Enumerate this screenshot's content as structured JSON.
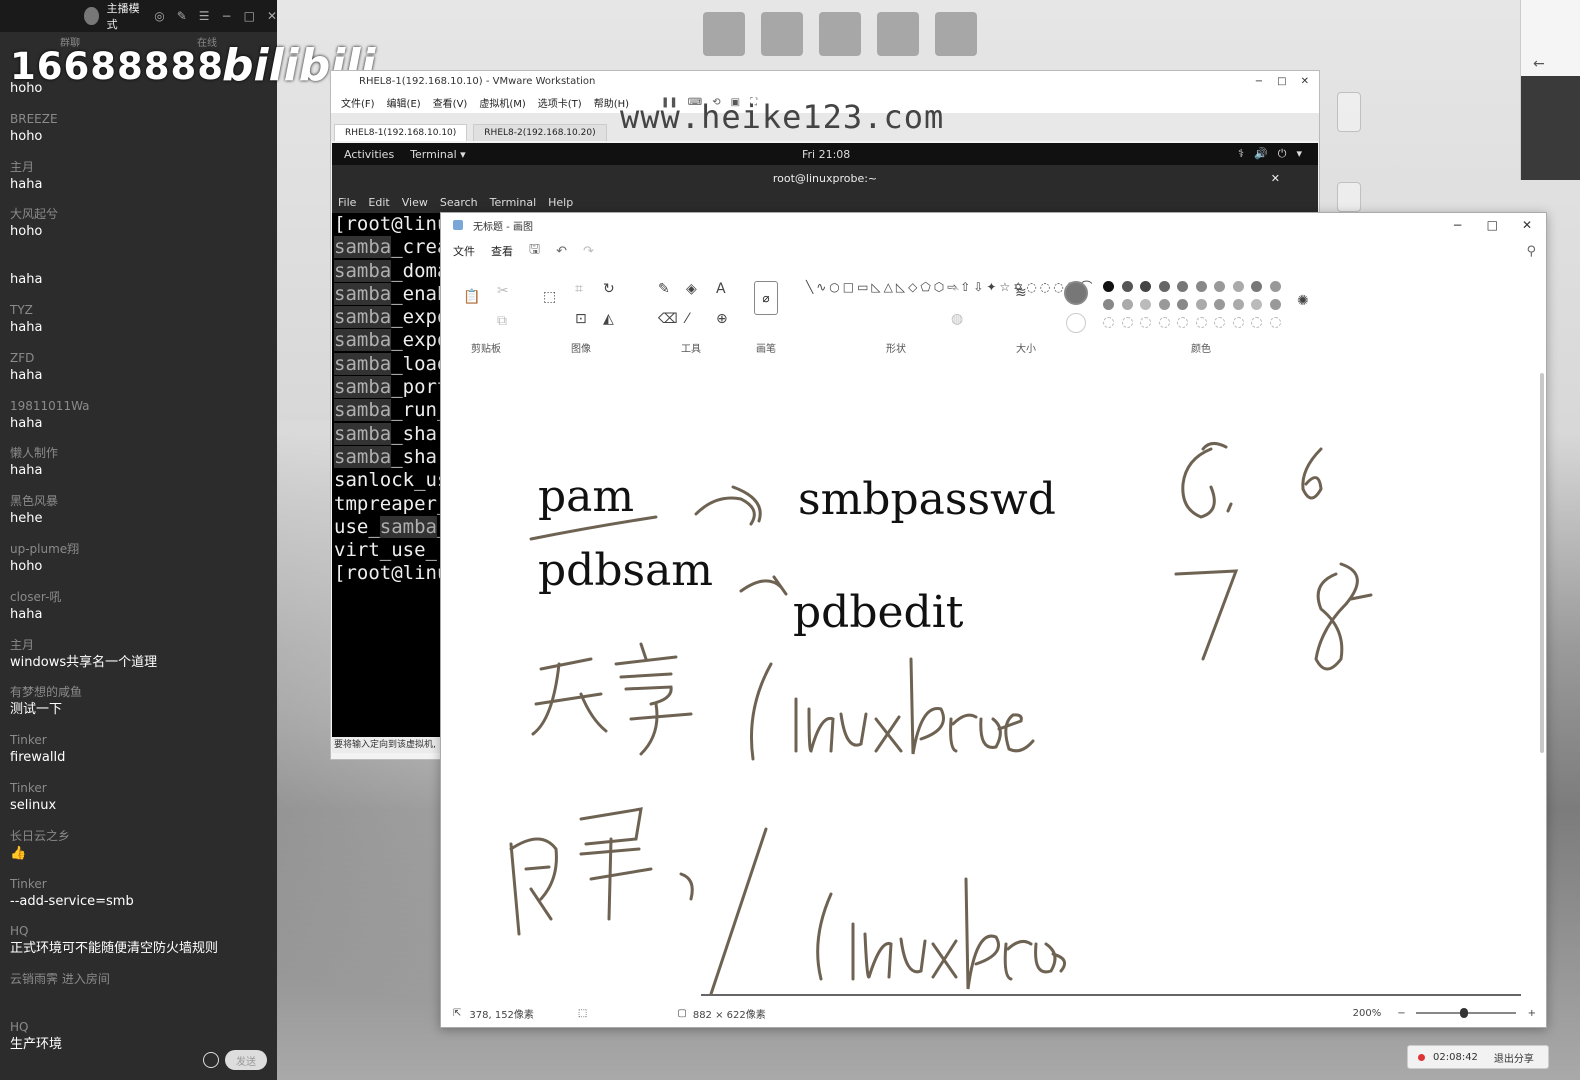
{
  "live": {
    "top_title": "主播模式",
    "tabs": [
      "群聊",
      "在线"
    ],
    "overlay_number": "16688888",
    "overlay_logo": "bilibili",
    "messages": [
      {
        "user": "",
        "text": "hoho"
      },
      {
        "user": "BREEZE",
        "text": "hoho"
      },
      {
        "user": "主月",
        "text": "haha"
      },
      {
        "user": "大风起兮",
        "text": "hoho"
      },
      {
        "user": "",
        "text": "haha"
      },
      {
        "user": "TYZ",
        "text": "haha"
      },
      {
        "user": "ZFD",
        "text": "haha"
      },
      {
        "user": "19811011Wa",
        "text": "haha"
      },
      {
        "user": "懒人制作",
        "text": "haha"
      },
      {
        "user": "黑色风暴",
        "text": "hehe"
      },
      {
        "user": "up-plume翔",
        "text": "hoho"
      },
      {
        "user": "closer-吼",
        "text": "haha"
      },
      {
        "user": "主月",
        "text": "windows共享名一个道理"
      },
      {
        "user": "有梦想的咸鱼",
        "text": "测试一下"
      },
      {
        "user": "Tinker",
        "text": "firewalld"
      },
      {
        "user": "Tinker",
        "text": "selinux"
      },
      {
        "user": "长日云之乡",
        "text": "👍"
      },
      {
        "user": "Tinker",
        "text": "--add-service=smb"
      },
      {
        "user": "HQ",
        "text": "正式环境可不能随便清空防火墙规则"
      },
      {
        "user": "云销雨霁 进入房间",
        "text": ""
      },
      {
        "user": "HQ",
        "text": "生产环境"
      }
    ],
    "send_label": "发送"
  },
  "vmware": {
    "title": "RHEL8-1(192.168.10.10) - VMware Workstation",
    "menu": [
      "文件(F)",
      "编辑(E)",
      "查看(V)",
      "虚拟机(M)",
      "选项卡(T)",
      "帮助(H)"
    ],
    "tabs": [
      "RHEL8-1(192.168.10.10)",
      "RHEL8-2(192.168.10.20)"
    ],
    "watermark": "www.heike123.com",
    "gnome": {
      "activities": "Activities",
      "app": "Terminal ▾",
      "clock": "Fri 21:08",
      "sys": [
        "⚕",
        "🔊",
        "⏻",
        "▾"
      ]
    },
    "terminal_title": "root@linuxprobe:~",
    "terminal_menu": [
      "File",
      "Edit",
      "View",
      "Search",
      "Terminal",
      "Help"
    ],
    "terminal_lines": [
      {
        "pre": "",
        "hl": "",
        "post": "[root@linu"
      },
      {
        "pre": "",
        "hl": "samba",
        "post": "_crea"
      },
      {
        "pre": "",
        "hl": "samba",
        "post": "_doma"
      },
      {
        "pre": "",
        "hl": "samba",
        "post": "_enab"
      },
      {
        "pre": "",
        "hl": "samba",
        "post": "_expo"
      },
      {
        "pre": "",
        "hl": "samba",
        "post": "_expo"
      },
      {
        "pre": "",
        "hl": "samba",
        "post": "_load"
      },
      {
        "pre": "",
        "hl": "samba",
        "post": "_port"
      },
      {
        "pre": "",
        "hl": "samba",
        "post": "_run_"
      },
      {
        "pre": "",
        "hl": "samba",
        "post": "_shar"
      },
      {
        "pre": "",
        "hl": "samba",
        "post": "_shar"
      },
      {
        "pre": "",
        "hl": "",
        "post": "sanlock_us"
      },
      {
        "pre": "",
        "hl": "",
        "post": "tmpreaper_"
      },
      {
        "pre": "use_",
        "hl": "samba",
        "post": "_"
      },
      {
        "pre": "",
        "hl": "",
        "post": "virt_use_"
      },
      {
        "pre": "",
        "hl": "",
        "post": "[root@linu"
      }
    ],
    "status": "要将输入定向到该虚拟机,"
  },
  "paint": {
    "title": "无标题 - 画图",
    "menu": [
      "文件",
      "查看"
    ],
    "groups": [
      "剪贴板",
      "图像",
      "工具",
      "画笔",
      "形状",
      "大小",
      "颜色"
    ],
    "colors": [
      "#111111",
      "#555555",
      "#444444",
      "#666666",
      "#777777",
      "#888888",
      "#999999",
      "#aaaaaa",
      "#777777",
      "#999999",
      "#888888",
      "#aaaaaa",
      "#bbbbbb",
      "#999999",
      "#888888",
      "#aaaaaa",
      "#999999",
      "#aaaaaa",
      "#bbbbbb",
      "#999999"
    ],
    "selected_color": "#777777",
    "canvas_text": {
      "pam": "pam",
      "smbpasswd": "smbpasswd",
      "pdbsam": "pdbsam",
      "pdbedit": "pdbedit"
    },
    "status": {
      "cursor": "378, 152像素",
      "size": "882 × 622像素",
      "zoom": "200%"
    }
  },
  "share": {
    "time": "02:08:42",
    "action": "退出分享"
  }
}
